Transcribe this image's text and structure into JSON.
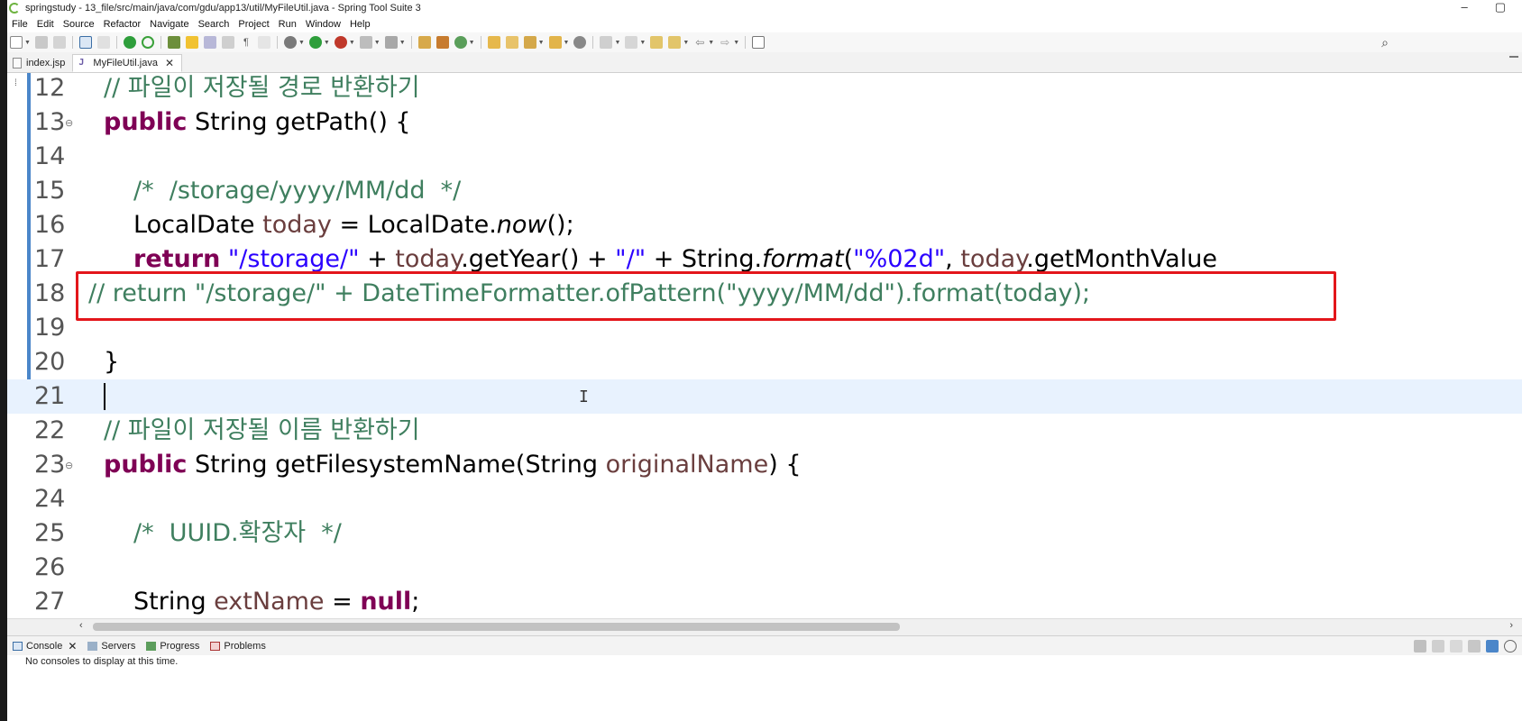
{
  "window": {
    "title": "springstudy - 13_file/src/main/java/com/gdu/app13/util/MyFileUtil.java - Spring Tool Suite 3",
    "minimize_label": "–",
    "restore_label": "▢"
  },
  "menu": [
    "File",
    "Edit",
    "Source",
    "Refactor",
    "Navigate",
    "Search",
    "Project",
    "Run",
    "Window",
    "Help"
  ],
  "editor_tabs": [
    {
      "label": "index.jsp",
      "active": false
    },
    {
      "label": "MyFileUtil.java",
      "active": true,
      "close": "✕"
    }
  ],
  "code_lines": [
    {
      "num": "12",
      "html": "<span class=\"cm\">// 파일이 저장될 경로 반환하기</span>",
      "indent": 115
    },
    {
      "num": "13",
      "fold": "⊖",
      "html": "<span class=\"kw\">public</span> String getPath() {",
      "indent": 115
    },
    {
      "num": "14",
      "html": "",
      "indent": 115
    },
    {
      "num": "15",
      "html": "<span class=\"cm\">/*  /storage/yyyy/MM/dd  */</span>",
      "indent": 148
    },
    {
      "num": "16",
      "html": "LocalDate <span class=\"var\">today</span> = LocalDate.<span class=\"it\">now</span>();",
      "indent": 148
    },
    {
      "num": "17",
      "html": "<span class=\"kw\">return</span> <span class=\"st\">\"/storage/\"</span> + <span class=\"var\">today</span>.getYear() + <span class=\"st\">\"/\"</span> + String.<span class=\"it\">format</span>(<span class=\"st\">\"%02d\"</span>, <span class=\"var\">today</span>.getMonthValue",
      "indent": 148
    },
    {
      "num": "18",
      "html": "<span class=\"cm\">// return \"/storage/\" + DateTimeFormatter.ofPattern(\"yyyy/MM/dd\").format(today);</span>",
      "indent": 98
    },
    {
      "num": "19",
      "html": "",
      "indent": 115
    },
    {
      "num": "20",
      "html": "}",
      "indent": 115
    },
    {
      "num": "21",
      "html": "",
      "indent": 115,
      "current": true
    },
    {
      "num": "22",
      "html": "<span class=\"cm\">// 파일이 저장될 이름 반환하기</span>",
      "indent": 115
    },
    {
      "num": "23",
      "fold": "⊖",
      "html": "<span class=\"kw\">public</span> String getFilesystemName(String <span class=\"var\">originalName</span>) {",
      "indent": 115
    },
    {
      "num": "24",
      "html": "",
      "indent": 115
    },
    {
      "num": "25",
      "html": "<span class=\"cm\">/*  UUID.확장자  */</span>",
      "indent": 148
    },
    {
      "num": "26",
      "html": "",
      "indent": 115
    },
    {
      "num": "27",
      "html": "String <span class=\"var\">extName</span> = <span class=\"kw\">null</span>;",
      "indent": 148
    }
  ],
  "bottom_tabs": [
    {
      "label": "Console",
      "close": "✕"
    },
    {
      "label": "Servers"
    },
    {
      "label": "Progress"
    },
    {
      "label": "Problems"
    }
  ],
  "status_text": "No consoles to display at this time.",
  "colors": {
    "keyword": "#7f0055",
    "comment": "#3f7f5f",
    "string": "#2a00ff",
    "variable": "#6a3e3e",
    "highlight_box": "#e3161b",
    "current_line": "#e8f2fe"
  }
}
